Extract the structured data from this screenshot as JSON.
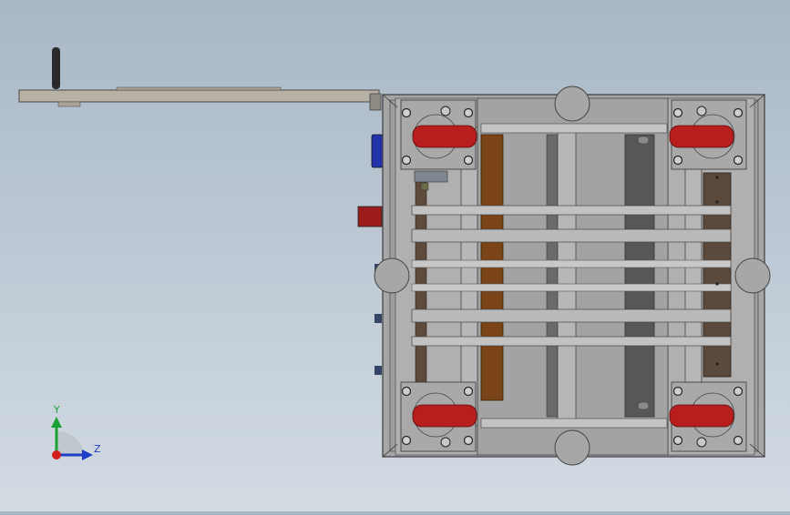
{
  "triad": {
    "y_label": "Y",
    "z_label": "Z",
    "colors": {
      "y": "#1aa033",
      "z": "#1f3fc8",
      "x": "#d21f1f"
    }
  },
  "colors": {
    "frame": "#9a9a9a",
    "frame_dark": "#5c5c5c",
    "wheel": "#b81e1e",
    "wood": "#7a4418",
    "handle": "#b5b0a6",
    "grip": "#2a2a2a",
    "blue_part": "#2233aa",
    "red_part": "#9c1c1c"
  }
}
